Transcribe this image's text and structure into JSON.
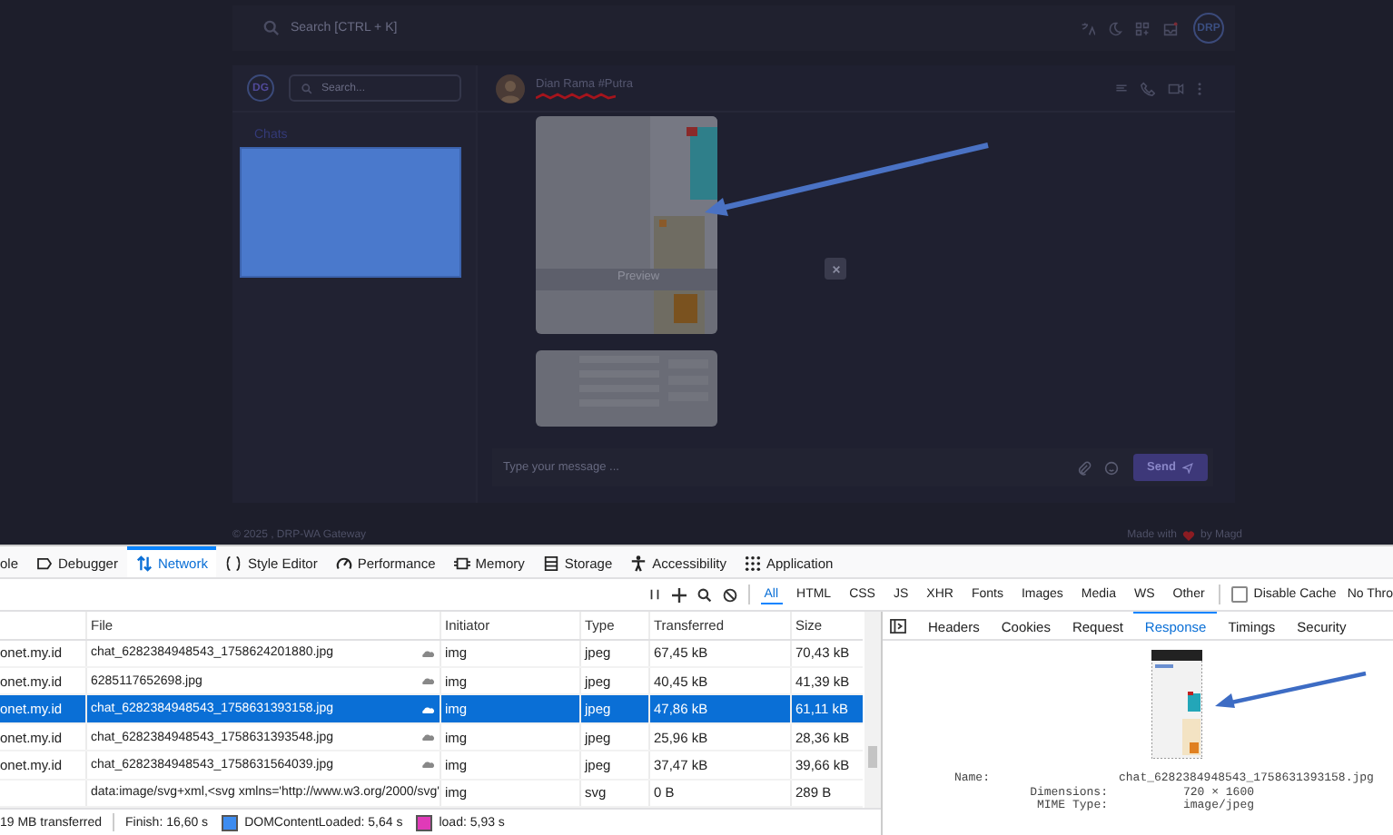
{
  "app": {
    "search_placeholder": "Search [CTRL + K]",
    "avatar_initials": "DRP",
    "sidebar": {
      "avatar_initials": "DG",
      "search_placeholder": "Search...",
      "section_title": "Chats"
    },
    "chat": {
      "contact_name": "Dian Rama #Putra",
      "message_placeholder": "Type your message ...",
      "send_label": "Send"
    },
    "preview": {
      "caption": "Preview"
    },
    "footer": {
      "copyright": "© 2025 , DRP-WA Gateway",
      "made_with": "Made with",
      "by": "by Magd"
    }
  },
  "devtools": {
    "tabs": [
      {
        "label": "ole",
        "selected": false
      },
      {
        "label": "Debugger",
        "selected": false
      },
      {
        "label": "Network",
        "selected": true
      },
      {
        "label": "Style Editor",
        "selected": false
      },
      {
        "label": "Performance",
        "selected": false
      },
      {
        "label": "Memory",
        "selected": false
      },
      {
        "label": "Storage",
        "selected": false
      },
      {
        "label": "Accessibility",
        "selected": false
      },
      {
        "label": "Application",
        "selected": false
      }
    ],
    "filters": [
      {
        "label": "All",
        "selected": true
      },
      {
        "label": "HTML",
        "selected": false
      },
      {
        "label": "CSS",
        "selected": false
      },
      {
        "label": "JS",
        "selected": false
      },
      {
        "label": "XHR",
        "selected": false
      },
      {
        "label": "Fonts",
        "selected": false
      },
      {
        "label": "Images",
        "selected": false
      },
      {
        "label": "Media",
        "selected": false
      },
      {
        "label": "WS",
        "selected": false
      },
      {
        "label": "Other",
        "selected": false
      }
    ],
    "disable_cache": {
      "label": "Disable Cache",
      "checked": false
    },
    "throttling": "No Thro",
    "table": {
      "columns": [
        "",
        "File",
        "Initiator",
        "Type",
        "Transferred",
        "Size"
      ],
      "rows": [
        {
          "domain": "onet.my.id",
          "file": "chat_6282384948543_1758624201880.jpg",
          "initiator": "img",
          "type": "jpeg",
          "transferred": "67,45 kB",
          "size": "70,43 kB",
          "selected": false
        },
        {
          "domain": "onet.my.id",
          "file": "6285117652698.jpg",
          "initiator": "img",
          "type": "jpeg",
          "transferred": "40,45 kB",
          "size": "41,39 kB",
          "selected": false
        },
        {
          "domain": "onet.my.id",
          "file": "chat_6282384948543_1758631393158.jpg",
          "initiator": "img",
          "type": "jpeg",
          "transferred": "47,86 kB",
          "size": "61,11 kB",
          "selected": true
        },
        {
          "domain": "onet.my.id",
          "file": "chat_6282384948543_1758631393548.jpg",
          "initiator": "img",
          "type": "jpeg",
          "transferred": "25,96 kB",
          "size": "28,36 kB",
          "selected": false
        },
        {
          "domain": "onet.my.id",
          "file": "chat_6282384948543_1758631564039.jpg",
          "initiator": "img",
          "type": "jpeg",
          "transferred": "37,47 kB",
          "size": "39,66 kB",
          "selected": false
        },
        {
          "domain": "",
          "file": "data:image/svg+xml,<svg xmlns='http://www.w3.org/2000/svg'",
          "initiator": "img",
          "type": "svg",
          "transferred": "0 B",
          "size": "289 B",
          "selected": false
        }
      ]
    },
    "status": {
      "transferred": "19 MB transferred",
      "finish": "Finish: 16,60 s",
      "dom_loaded": "DOMContentLoaded: 5,64 s",
      "load": "load: 5,93 s"
    },
    "details": {
      "tabs": [
        {
          "label": "Headers",
          "selected": false
        },
        {
          "label": "Cookies",
          "selected": false
        },
        {
          "label": "Request",
          "selected": false
        },
        {
          "label": "Response",
          "selected": true
        },
        {
          "label": "Timings",
          "selected": false
        },
        {
          "label": "Security",
          "selected": false
        }
      ],
      "fields": [
        {
          "label": "Name:",
          "value": "chat_6282384948543_1758631393158.jpg"
        },
        {
          "label": "Dimensions:",
          "value": "720 × 1600"
        },
        {
          "label": "MIME Type:",
          "value": "image/jpeg"
        }
      ]
    }
  }
}
